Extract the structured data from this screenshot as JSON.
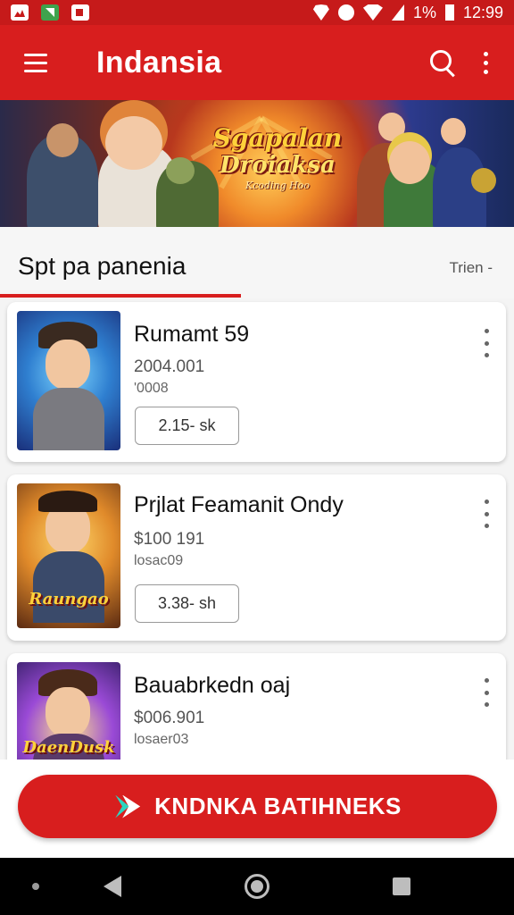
{
  "status_bar": {
    "battery": "1%",
    "time": "12:99"
  },
  "app_bar": {
    "title": "Indansia"
  },
  "banner": {
    "title_line1": "Sgapalan",
    "title_line2": "Droiaksa",
    "tagline": "Kcoding Hoo"
  },
  "section": {
    "title": "Spt pa panenia",
    "link": "Trien -"
  },
  "cards": [
    {
      "title": "Rumamt 59",
      "sub1": "2004.001",
      "sub2": "'0008",
      "button": "2.15- sk",
      "thumb_logo": ""
    },
    {
      "title": "Prjlat Feamanit Ondy",
      "sub1": "$100 191",
      "sub2": "losac09",
      "button": "3.38- sh",
      "thumb_logo": "Raungao"
    },
    {
      "title": "Bauabrkedn oaj",
      "sub1": "$006.901",
      "sub2": "losaer03",
      "button": "",
      "thumb_logo": "DaenDusk"
    }
  ],
  "cta": {
    "label": "KNDNKA BATIHNEKS"
  },
  "colors": {
    "primary": "#d81e1e",
    "status_bar": "#c61a1a",
    "cta_icon_accent": "#2dd4bf"
  },
  "icons": {
    "app_bar": [
      "menu-icon",
      "search-icon",
      "more-vert-icon"
    ],
    "nav_bar": [
      "nav-dot",
      "back-icon",
      "home-icon",
      "recents-icon"
    ]
  }
}
